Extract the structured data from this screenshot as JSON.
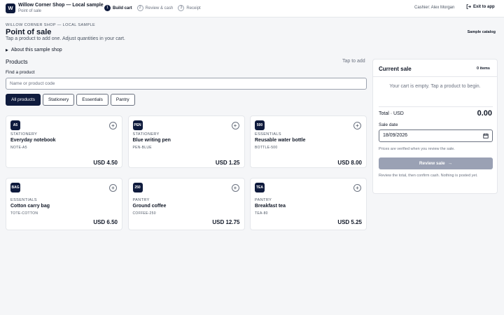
{
  "app": {
    "logo_letter": "W",
    "title": "Willow Corner Shop — Local sample",
    "subtitle": "Point of sale"
  },
  "steps": [
    {
      "num": "1",
      "label": "Build cart",
      "active": true
    },
    {
      "num": "2",
      "label": "Review & cash",
      "active": false
    },
    {
      "num": "3",
      "label": "Receipt",
      "active": false
    }
  ],
  "header": {
    "cashier": "Cashier: Alex Morgan",
    "exit_label": "Exit to app",
    "shop_label": "WILLOW CORNER SHOP — LOCAL SAMPLE",
    "page_title": "Point of sale",
    "description": "Tap a product to add one. Adjust quantities in your cart.",
    "sample_catalog": "Sample catalog",
    "about_label": "About this sample shop"
  },
  "products": {
    "heading": "Products",
    "tap_hint": "Tap to add",
    "find_label": "Find a product",
    "search_placeholder": "Name or product code",
    "filters": [
      "All products",
      "Stationery",
      "Essentials",
      "Pantry"
    ],
    "active_filter": "All products",
    "items": [
      {
        "badge": "A5",
        "category": "STATIONERY",
        "name": "Everyday notebook",
        "sku": "NOTE-A5",
        "price": "USD 4.50"
      },
      {
        "badge": "PEN",
        "category": "STATIONERY",
        "name": "Blue writing pen",
        "sku": "PEN-BLUE",
        "price": "USD 1.25"
      },
      {
        "badge": "500",
        "category": "ESSENTIALS",
        "name": "Reusable water bottle",
        "sku": "BOTTLE-500",
        "price": "USD 8.00"
      },
      {
        "badge": "BAG",
        "category": "ESSENTIALS",
        "name": "Cotton carry bag",
        "sku": "TOTE-COTTON",
        "price": "USD 6.50"
      },
      {
        "badge": "250",
        "category": "PANTRY",
        "name": "Ground coffee",
        "sku": "COFFEE-250",
        "price": "USD 12.75"
      },
      {
        "badge": "TEA",
        "category": "PANTRY",
        "name": "Breakfast tea",
        "sku": "TEA-80",
        "price": "USD 5.25"
      }
    ]
  },
  "sale": {
    "title": "Current sale",
    "item_count": "0 items",
    "empty_message": "Your cart is empty. Tap a product to begin.",
    "total_label": "Total · USD",
    "total_amount": "0.00",
    "date_label": "Sale date",
    "date_value": "18/09/2026",
    "verify_note": "Prices are verified when you review the sale.",
    "review_button": "Review sale",
    "confirm_note": "Review the total, then confirm cash. Nothing is posted yet."
  },
  "colors": {
    "brand": "#0f1b3d",
    "disabled_button": "#9aa1b4",
    "background": "#f5f6f8"
  }
}
